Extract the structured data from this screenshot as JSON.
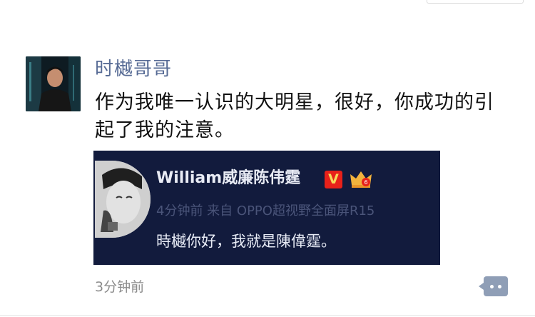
{
  "post": {
    "username": "时樾哥哥",
    "text": "作为我唯一认识的大明星，很好，你成功的引起了我的注意。",
    "time": "3分钟前"
  },
  "shared_card": {
    "name": "William威廉陈伟霆",
    "verified_badge": "V",
    "meta": "4分钟前 来自 OPPO超视野全面屏R15",
    "text": "時樾你好，我就是陳偉霆。"
  },
  "icons": {
    "avatar": "user-avatar-photo",
    "card_avatar": "celebrity-avatar-photo",
    "vip": "crown-icon",
    "comment": "comment-icon"
  },
  "colors": {
    "username": "#576b95",
    "card_bg": "#121b3d",
    "badge": "#e8211a",
    "comment_button": "#8f9eb6"
  }
}
